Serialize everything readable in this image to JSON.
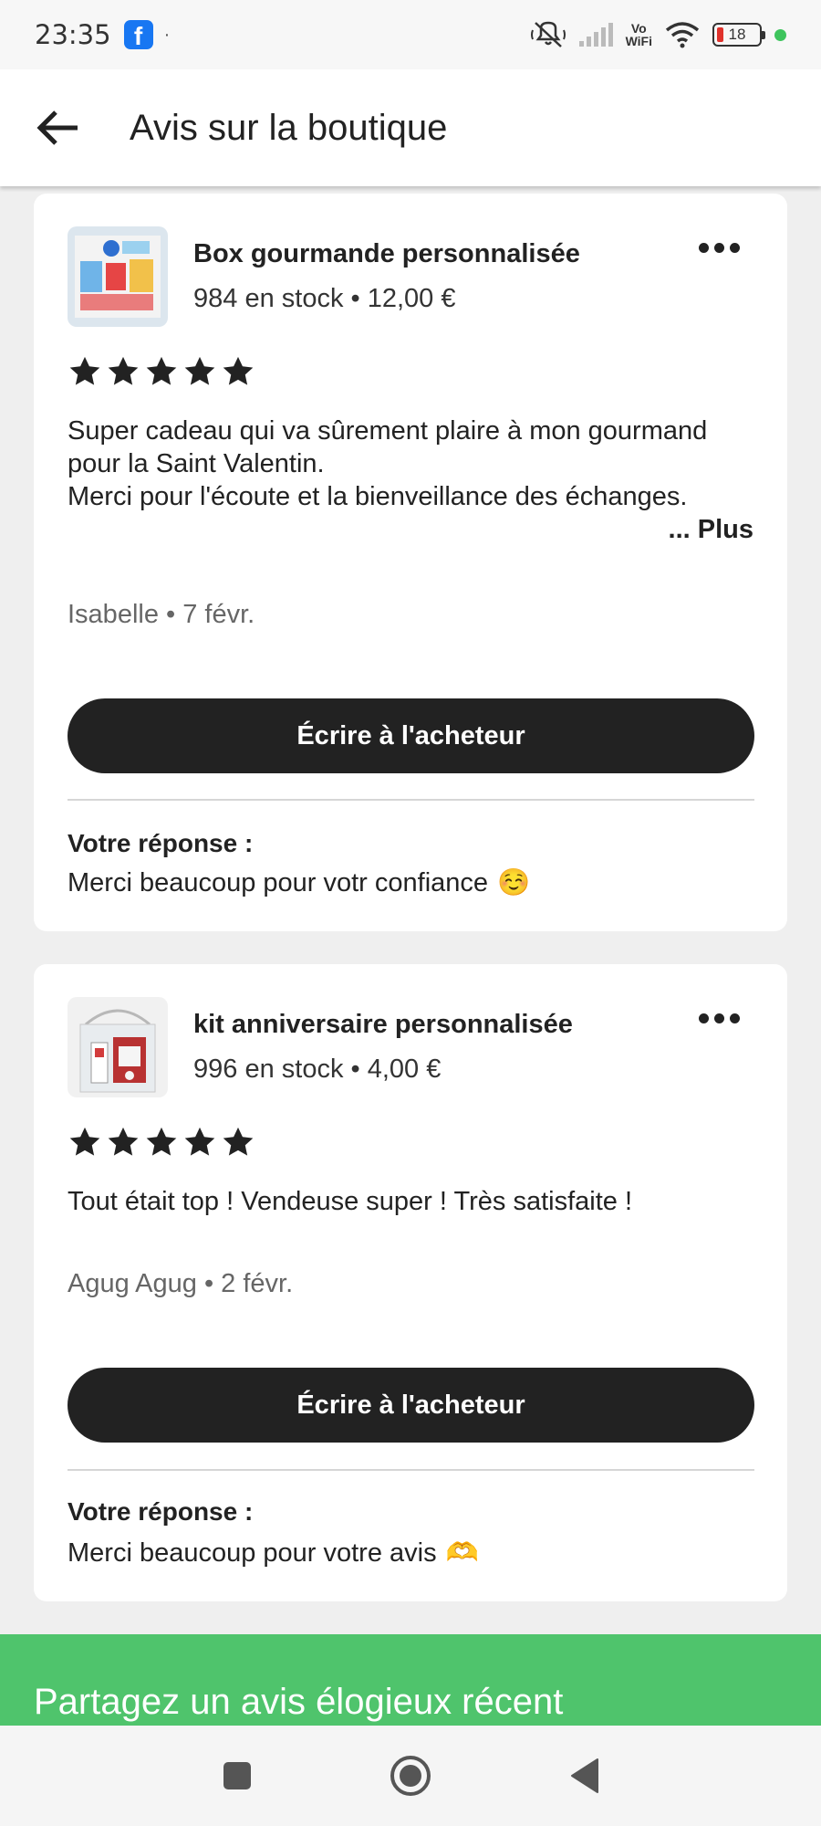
{
  "status_bar": {
    "time": "23:35",
    "facebook_icon": "facebook-icon",
    "dot": "·",
    "vowifi_top": "Vo",
    "vowifi_bottom": "WiFi",
    "battery": "18",
    "icons": [
      "mute-icon",
      "signal-icon",
      "vowifi-icon",
      "wifi-icon",
      "battery-icon",
      "privacy-dot-icon"
    ],
    "colors": {
      "battery_low": "#e0322c",
      "privacy_dot": "#3ec45d",
      "facebook": "#1877f2"
    }
  },
  "header": {
    "title": "Avis sur la boutique",
    "back_icon": "arrow-left-icon"
  },
  "reviews": [
    {
      "product_title": "Box gourmande personnalisée",
      "product_meta": "984 en stock • 12,00 €",
      "rating": 5,
      "text": "Super cadeau qui va sûrement plaire à mon gourmand pour la Saint Valentin.\nMerci pour l'écoute et la bienveillance des échanges.",
      "more_label": "... Plus",
      "author": "Isabelle • 7 févr.",
      "button_label": "Écrire à l'acheteur",
      "reply_label": "Votre réponse :",
      "reply_text": "Merci beaucoup pour votr confiance",
      "reply_emoji": "☺️"
    },
    {
      "product_title": "kit anniversaire personnalisée",
      "product_meta": "996 en stock • 4,00 €",
      "rating": 5,
      "text": "Tout était top ! Vendeuse super ! Très satisfaite !",
      "author": "Agug Agug • 2 févr.",
      "button_label": "Écrire à l'acheteur",
      "reply_label": "Votre réponse :",
      "reply_text": "Merci beaucoup pour votre avis",
      "reply_emoji": "🫶"
    }
  ],
  "promo": {
    "title": "Partagez un avis élogieux récent",
    "color": "#4fc46c"
  },
  "nav_bar": {
    "icons": [
      "recents-square-icon",
      "home-circle-icon",
      "back-triangle-icon"
    ]
  }
}
